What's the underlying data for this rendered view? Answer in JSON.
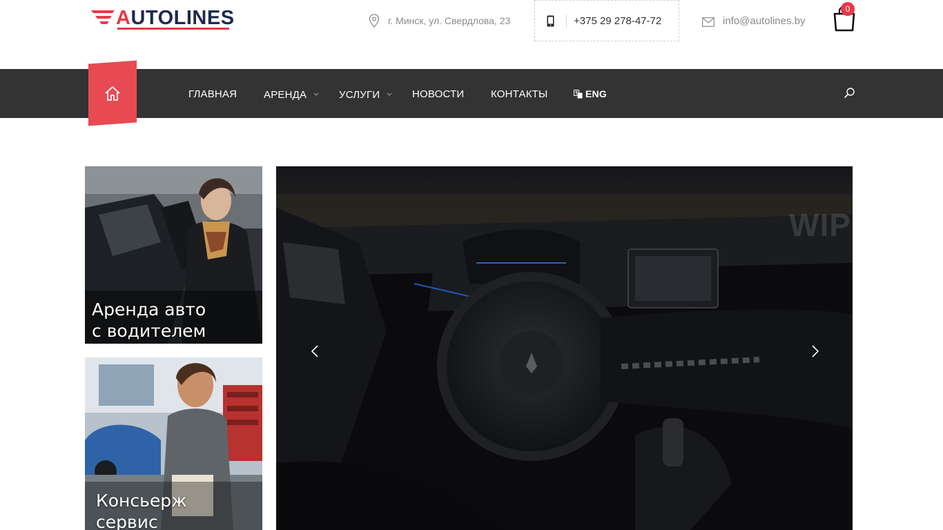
{
  "brand": {
    "logo_text_accent": "A",
    "logo_text_rest": "UTOLINES",
    "accent_color": "#e63946",
    "dark_color": "#1f2a4a"
  },
  "header": {
    "address": "г. Минск, ул. Свердлова, 23",
    "phone": "+375 29 278-47-72",
    "email": "info@autolines.by",
    "cart_count": "0",
    "icons": {
      "address": "location-pin-icon",
      "phone": "mobile-phone-icon",
      "email": "envelope-icon",
      "cart": "shopping-bag-icon"
    }
  },
  "nav": {
    "home_icon": "home-icon",
    "items": [
      {
        "label": "ГЛАВНАЯ",
        "has_submenu": false
      },
      {
        "label": "АРЕНДА",
        "has_submenu": true
      },
      {
        "label": "УСЛУГИ",
        "has_submenu": true
      },
      {
        "label": "НОВОСТИ",
        "has_submenu": false
      },
      {
        "label": "КОНТАКТЫ",
        "has_submenu": false
      }
    ],
    "language": {
      "label": "ENG",
      "icon": "translate-icon"
    },
    "search_icon": "search-icon",
    "bar_color": "#333333",
    "home_color": "#e84a53"
  },
  "cards": [
    {
      "title_line1": "Аренда авто",
      "title_line2": "с водителем"
    },
    {
      "title_line1": "Консьерж",
      "title_line2": "сервис"
    }
  ],
  "slider": {
    "watermark": "WIP",
    "prev_icon": "chevron-left-icon",
    "next_icon": "chevron-right-icon"
  }
}
